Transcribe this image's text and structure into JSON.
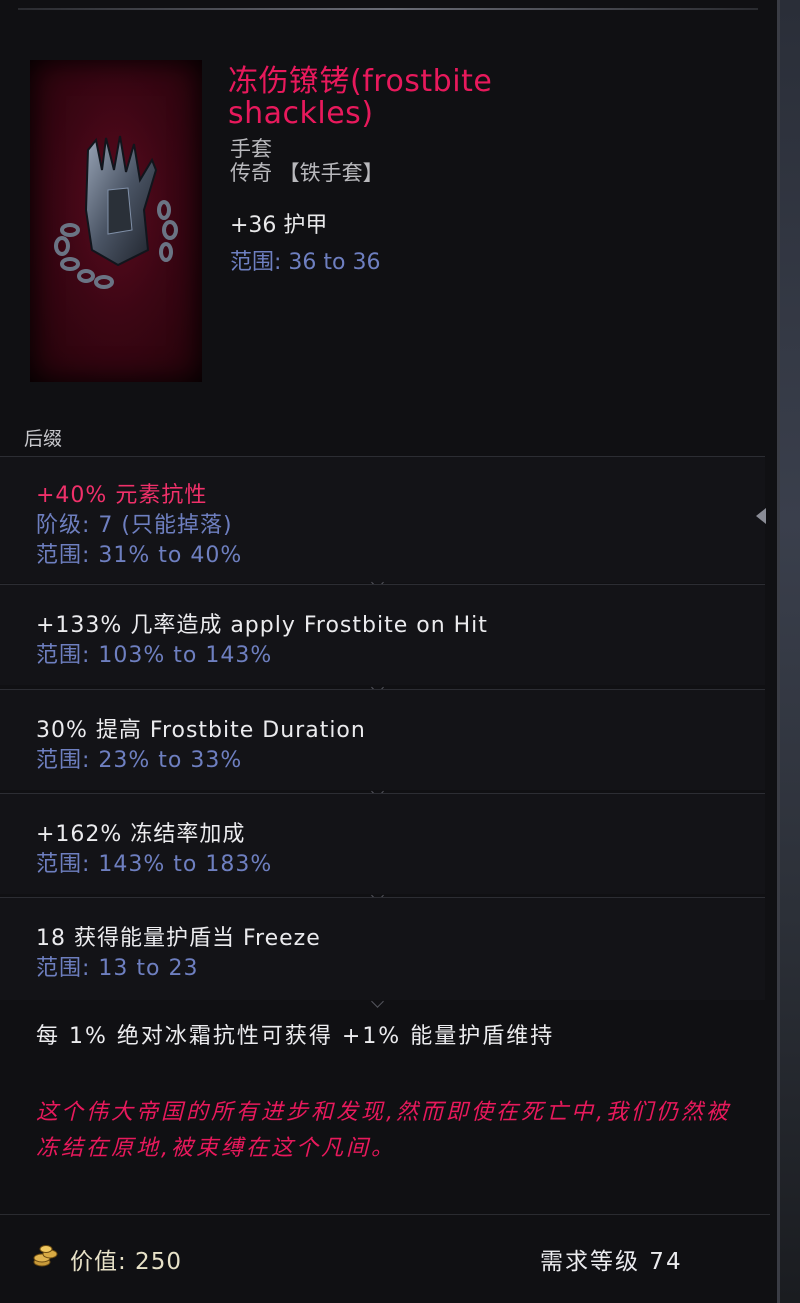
{
  "item": {
    "name": "冻伤镣铐(frostbite shackles)",
    "type": "手套",
    "rarity": "传奇  【铁手套】",
    "base_stat": "+36 护甲",
    "base_range": "范围: 36 to 36"
  },
  "suffix_label": "后缀",
  "affixes": [
    {
      "lines": [
        {
          "text": "+40% 元素抗性",
          "color": "pink"
        },
        {
          "text": "阶级: 7 (只能掉落)",
          "color": "blue"
        },
        {
          "text": "范围: 31% to 40%",
          "color": "blue"
        }
      ]
    },
    {
      "lines": [
        {
          "text": "+133% 几率造成 apply Frostbite on Hit",
          "color": "white"
        },
        {
          "text": "范围: 103% to 143%",
          "color": "blue"
        }
      ]
    },
    {
      "lines": [
        {
          "text": "30% 提高 Frostbite Duration",
          "color": "white"
        },
        {
          "text": "范围: 23% to 33%",
          "color": "blue"
        }
      ]
    },
    {
      "lines": [
        {
          "text": "+162% 冻结率加成",
          "color": "white"
        },
        {
          "text": "范围: 143% to 183%",
          "color": "blue"
        }
      ]
    },
    {
      "lines": [
        {
          "text": "18 获得能量护盾当 Freeze",
          "color": "white"
        },
        {
          "text": "范围: 13 to 23",
          "color": "blue"
        }
      ]
    }
  ],
  "implicit": "每 1% 绝对冰霜抗性可获得 +1% 能量护盾维持",
  "lore": "这个伟大帝国的所有进步和发现,然而即使在死亡中,我们仍然被冻结在原地,被束缚在这个凡间。",
  "footer": {
    "value": "价值: 250",
    "required_level": "需求等级  74",
    "icon": "gold-coins-icon"
  },
  "colors": {
    "legendary_name": "#e8195c",
    "range_blue": "#6e7fc0",
    "affix_pink": "#f0306a"
  }
}
